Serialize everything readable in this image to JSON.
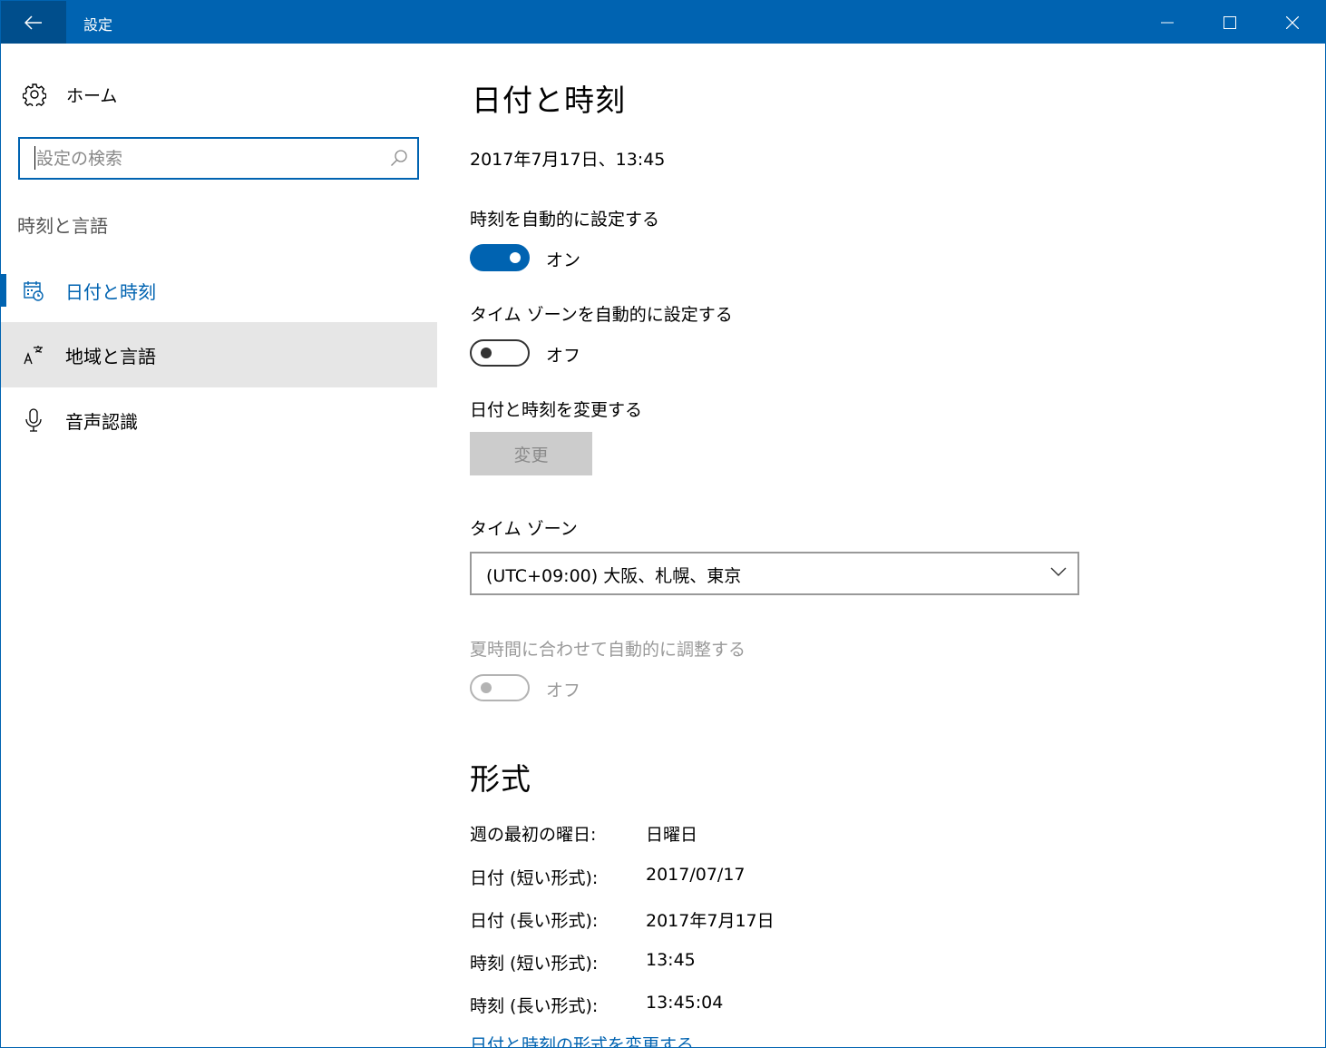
{
  "window": {
    "title": "設定"
  },
  "sidebar": {
    "home_label": "ホーム",
    "search_placeholder": "設定の検索",
    "section_label": "時刻と言語",
    "items": [
      {
        "label": "日付と時刻",
        "icon": "calendar-clock-icon",
        "selected": true
      },
      {
        "label": "地域と言語",
        "icon": "language-icon",
        "hovered": true
      },
      {
        "label": "音声認識",
        "icon": "microphone-icon"
      }
    ]
  },
  "main": {
    "title": "日付と時刻",
    "current_datetime": "2017年7月17日、13:45",
    "auto_time": {
      "label": "時刻を自動的に設定する",
      "state": "オン",
      "on": true
    },
    "auto_timezone": {
      "label": "タイム ゾーンを自動的に設定する",
      "state": "オフ",
      "on": false
    },
    "change_datetime": {
      "label": "日付と時刻を変更する",
      "button": "変更"
    },
    "timezone": {
      "label": "タイム ゾーン",
      "value": "(UTC+09:00) 大阪、札幌、東京"
    },
    "dst": {
      "label": "夏時間に合わせて自動的に調整する",
      "state": "オフ",
      "enabled": false
    },
    "formats": {
      "title": "形式",
      "rows": [
        {
          "key": "週の最初の曜日:",
          "value": "日曜日"
        },
        {
          "key": "日付 (短い形式):",
          "value": "2017/07/17"
        },
        {
          "key": "日付 (長い形式):",
          "value": "2017年7月17日"
        },
        {
          "key": "時刻 (短い形式):",
          "value": "13:45"
        },
        {
          "key": "時刻 (長い形式):",
          "value": "13:45:04"
        }
      ],
      "link": "日付と時刻の形式を変更する"
    }
  },
  "colors": {
    "accent": "#0063b1",
    "hover": "#e6e6e6",
    "disabled": "#cccccc"
  }
}
